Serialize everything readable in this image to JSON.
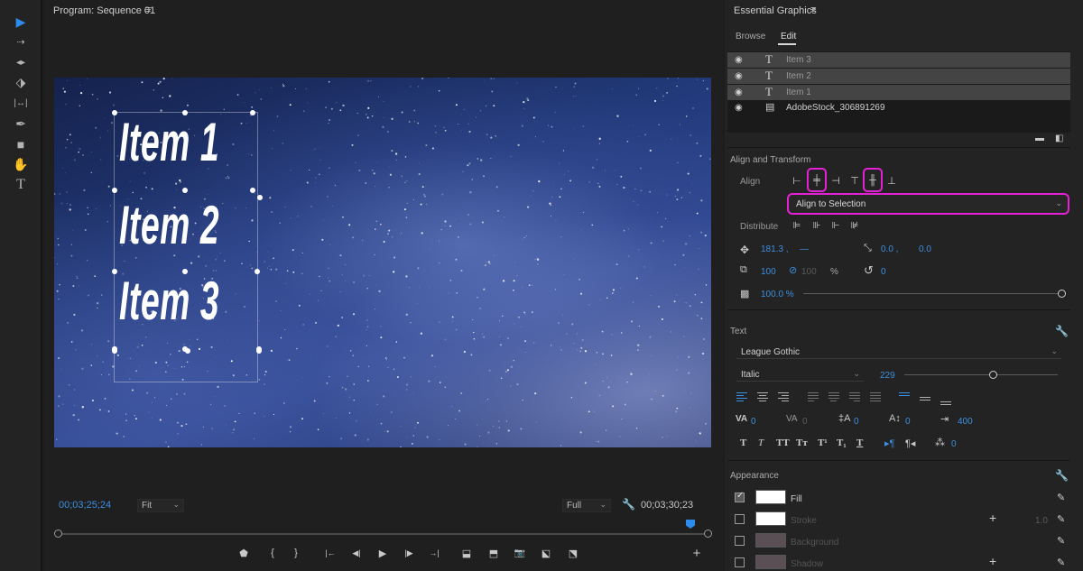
{
  "toolbar": {
    "tools": [
      "selection-tool",
      "track-select-tool",
      "ripple-edit-tool",
      "razor-tool",
      "slip-tool",
      "pen-tool",
      "rectangle-tool",
      "hand-tool",
      "type-tool"
    ],
    "tool_glyphs": [
      "▶",
      "⇢",
      "◂▸",
      "⬗",
      "|↔|",
      "✒",
      "■",
      "✋",
      "T"
    ]
  },
  "monitor": {
    "title": "Program: Sequence 01",
    "menu_glyph": "≡",
    "video_text": [
      "Item 1",
      "Item 2",
      "Item 3"
    ],
    "timecode_current": "00;03;25;24",
    "timecode_duration": "00;03;30;23",
    "zoom_select": "Fit",
    "quality_select": "Full",
    "playhead_fraction": 0.99,
    "transport_glyphs": [
      "⬟",
      "{",
      "}",
      "|←",
      "◀|",
      "▶",
      "|▶",
      "→|",
      "⬓",
      "⬒",
      "📷",
      "⬕",
      "⬔",
      "+"
    ]
  },
  "essential_graphics": {
    "title": "Essential Graphics",
    "menu_glyph": "≡",
    "tabs": [
      "Browse",
      "Edit"
    ],
    "active_tab": "Edit",
    "layers": [
      {
        "name": "Item 3",
        "type": "T",
        "selected": true
      },
      {
        "name": "Item 2",
        "type": "T",
        "selected": true
      },
      {
        "name": "Item 1",
        "type": "T",
        "selected": true
      },
      {
        "name": "AdobeStock_306891269",
        "type": "▤",
        "selected": false
      }
    ],
    "align_transform": {
      "heading": "Align and Transform",
      "align_label": "Align",
      "align_to": "Align to Selection",
      "distribute_label": "Distribute",
      "position_x": "181.3 ,",
      "position_y": "—",
      "anchor_x": "0.0 ,",
      "anchor_y": "0.0",
      "scale": "100",
      "scale_linked": "100",
      "scale_unit": "%",
      "rotation": "0",
      "opacity": "100.0 %",
      "opacity_level": 1.0
    },
    "text": {
      "heading": "Text",
      "font": "League Gothic",
      "style": "Italic",
      "size": "229",
      "size_level": 0.58,
      "tracking_va": "0",
      "kerning_va": "0",
      "leading": "0",
      "baseline": "0",
      "tab_width": "400",
      "tsume": "0",
      "type_buttons": [
        "T",
        "T",
        "TT",
        "Tт",
        "T¹",
        "T₁",
        "T"
      ]
    },
    "appearance": {
      "heading": "Appearance",
      "rows": [
        {
          "label": "Fill",
          "checked": true,
          "color": "#ffffff",
          "has_plus": false,
          "value": ""
        },
        {
          "label": "Stroke",
          "checked": false,
          "color": "#ffffff",
          "has_plus": true,
          "value": "1.0"
        },
        {
          "label": "Background",
          "checked": false,
          "color": "#5a4f55",
          "has_plus": false,
          "value": ""
        },
        {
          "label": "Shadow",
          "checked": false,
          "color": "#5a4f55",
          "has_plus": true,
          "value": ""
        }
      ]
    },
    "highlight_color": "#e521d5",
    "accent_color": "#3d8fe0"
  }
}
